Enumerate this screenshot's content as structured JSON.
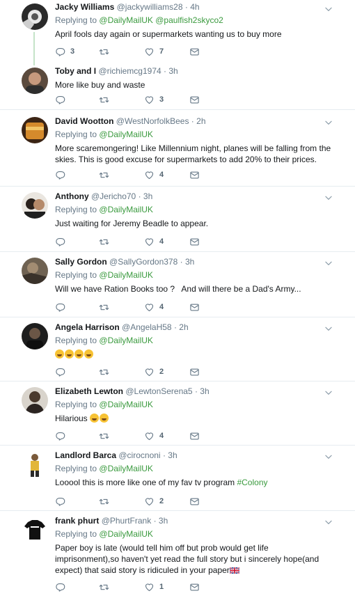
{
  "colors": {
    "link": "#3a9a3e",
    "muted": "#657786",
    "divider": "#e6ecf0"
  },
  "tweets": [
    {
      "name": "Jacky Williams",
      "handle": "@jackywilliams28",
      "dot": "·",
      "time": "4h",
      "replying_prefix": "Replying to",
      "replying_to": "@DailyMailUK @paulfish2skyco2",
      "text": "April fools day again or supermarkets wanting us to buy more",
      "counts": {
        "reply": "3",
        "retweet": "",
        "like": "7"
      }
    },
    {
      "name": "Toby and I",
      "handle": "@richiemcg1974",
      "dot": "·",
      "time": "3h",
      "text": "More like buy and waste",
      "counts": {
        "reply": "",
        "retweet": "",
        "like": "3"
      }
    },
    {
      "name": "David Wootton",
      "handle": "@WestNorfolkBees",
      "dot": "·",
      "time": "2h",
      "replying_prefix": "Replying to",
      "replying_to": "@DailyMailUK",
      "text": "More scaremongering! Like Millennium night, planes will be falling from the skies. This is good excuse for supermarkets to add 20% to their prices.",
      "counts": {
        "reply": "",
        "retweet": "",
        "like": "4"
      }
    },
    {
      "name": "Anthony",
      "handle": "@Jericho70",
      "dot": "·",
      "time": "3h",
      "replying_prefix": "Replying to",
      "replying_to": "@DailyMailUK",
      "text": "Just waiting for Jeremy Beadle to appear.",
      "counts": {
        "reply": "",
        "retweet": "",
        "like": "4"
      }
    },
    {
      "name": "Sally Gordon",
      "handle": "@SallyGordon378",
      "dot": "·",
      "time": "3h",
      "replying_prefix": "Replying to",
      "replying_to": "@DailyMailUK",
      "text": "Will we have Ration Books too ?   And will there be a Dad's Army...",
      "counts": {
        "reply": "",
        "retweet": "",
        "like": "4"
      }
    },
    {
      "name": "Angela Harrison",
      "handle": "@AngelaH58",
      "dot": "·",
      "time": "2h",
      "replying_prefix": "Replying to",
      "replying_to": "@DailyMailUK",
      "text": "",
      "counts": {
        "reply": "",
        "retweet": "",
        "like": "2"
      }
    },
    {
      "name": "Elizabeth Lewton",
      "handle": "@LewtonSerena5",
      "dot": "·",
      "time": "3h",
      "replying_prefix": "Replying to",
      "replying_to": "@DailyMailUK",
      "text": "Hilarious",
      "counts": {
        "reply": "",
        "retweet": "",
        "like": "4"
      }
    },
    {
      "name": "Landlord Barca",
      "handle": "@cirocnoni",
      "dot": "·",
      "time": "3h",
      "replying_prefix": "Replying to",
      "replying_to": "@DailyMailUK",
      "text": "Looool this is more like one of my fav tv program",
      "hashtag": "#Colony",
      "counts": {
        "reply": "",
        "retweet": "",
        "like": "2"
      }
    },
    {
      "name": "frank phurt",
      "handle": "@PhurtFrank",
      "dot": "·",
      "time": "3h",
      "replying_prefix": "Replying to",
      "replying_to": "@DailyMailUK",
      "text": "Paper boy is late (would tell him off but prob would get life imprisonment),so haven't yet read the full story but i sincerely hope(and expect) that said story is ridiculed in your paper",
      "counts": {
        "reply": "",
        "retweet": "",
        "like": "1"
      }
    }
  ]
}
